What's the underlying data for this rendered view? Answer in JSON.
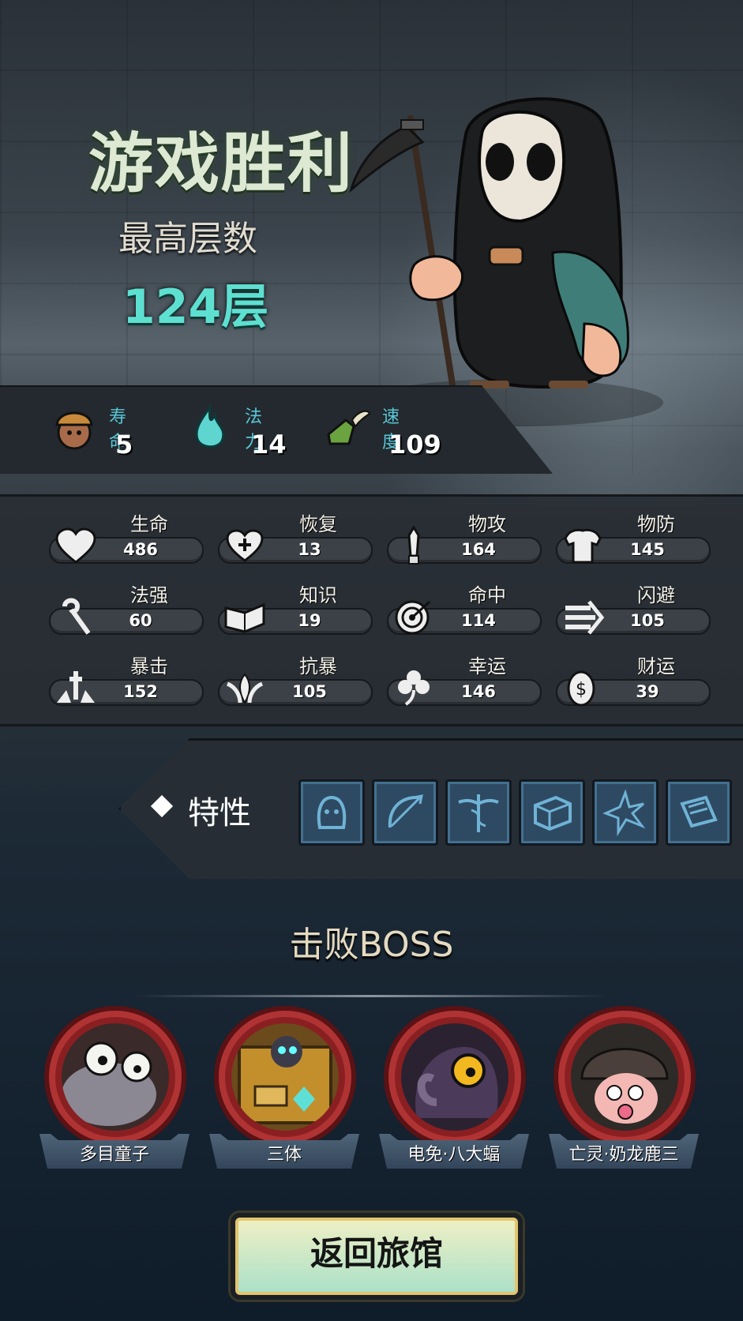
{
  "result": {
    "title": "游戏胜利",
    "subtitle": "最高层数",
    "floors": "124层"
  },
  "vitals": [
    {
      "label": "寿命",
      "value": "5",
      "icon": "life-icon"
    },
    {
      "label": "法力",
      "value": "14",
      "icon": "mana-flame-icon"
    },
    {
      "label": "速度",
      "value": "109",
      "icon": "winged-boot-icon"
    }
  ],
  "stats": [
    {
      "label": "生命",
      "value": "486",
      "icon": "heart-icon"
    },
    {
      "label": "恢复",
      "value": "13",
      "icon": "heal-heart-icon"
    },
    {
      "label": "物攻",
      "value": "164",
      "icon": "sword-icon"
    },
    {
      "label": "物防",
      "value": "145",
      "icon": "armor-icon"
    },
    {
      "label": "法强",
      "value": "60",
      "icon": "staff-icon"
    },
    {
      "label": "知识",
      "value": "19",
      "icon": "book-icon"
    },
    {
      "label": "命中",
      "value": "114",
      "icon": "target-icon"
    },
    {
      "label": "闪避",
      "value": "105",
      "icon": "dodge-arrows-icon"
    },
    {
      "label": "暴击",
      "value": "152",
      "icon": "crit-icon"
    },
    {
      "label": "抗暴",
      "value": "105",
      "icon": "crit-resist-icon"
    },
    {
      "label": "幸运",
      "value": "146",
      "icon": "clover-icon"
    },
    {
      "label": "财运",
      "value": "39",
      "icon": "coin-icon"
    }
  ],
  "traits": {
    "label": "特性",
    "items": [
      "ghost-trait-icon",
      "bow-trait-icon",
      "caduceus-trait-icon",
      "chest-trait-icon",
      "star-burst-trait-icon",
      "scroll-trait-icon"
    ]
  },
  "bosses": {
    "title": "击败BOSS",
    "items": [
      {
        "name": "多目童子"
      },
      {
        "name": "三体"
      },
      {
        "name": "电免·八大蝠"
      },
      {
        "name": "亡灵·奶龙鹿三"
      }
    ]
  },
  "return_button": "返回旅馆"
}
